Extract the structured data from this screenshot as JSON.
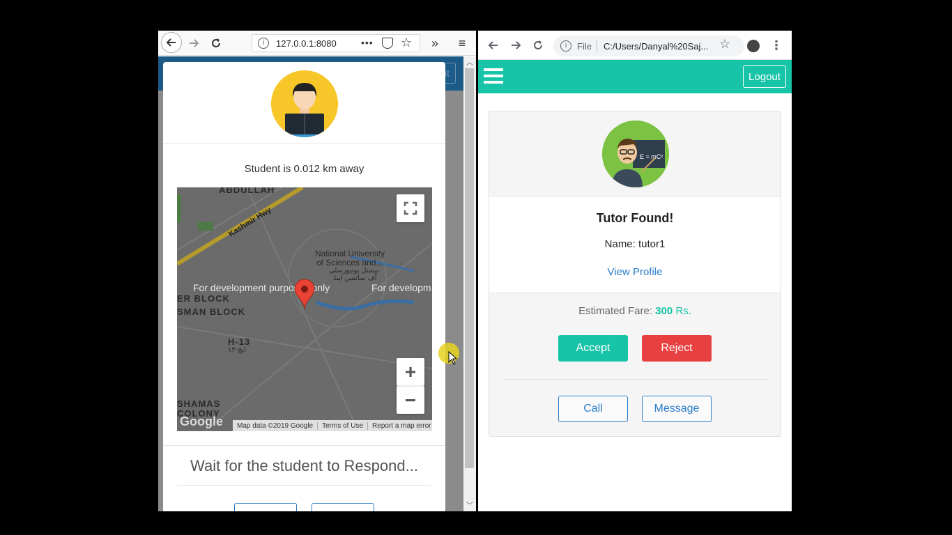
{
  "left_browser": {
    "url": "127.0.0.1:8080",
    "nav_icons": [
      "back-icon",
      "forward-icon",
      "reload-icon",
      "info-icon",
      "more-icon",
      "pocket-icon",
      "star-icon",
      "overflow-icon",
      "menu-icon"
    ],
    "background_logout": "Logout",
    "modal": {
      "distance_text": "Student is 0.012 km away",
      "map": {
        "labels": {
          "abdullah": "ABDULLAH",
          "kashmir_hwy": "Kashmir Hwy",
          "university": "National University",
          "university_2": "of Sciences and...",
          "urdu_1": "نیشنل یونیورسٹی",
          "urdu_2": "آف سائنس اینڈ",
          "dev_1": "For development purposes only",
          "dev_2": "For developm",
          "er_block": "ER BLOCK",
          "usman_block": "SMAN BLOCK",
          "h13": "H-13",
          "h13_urdu": "ایچ-۱۳",
          "shamas": "SHAMAS",
          "colony": "COLONY"
        },
        "google_logo": "Google",
        "footer": [
          "Map data ©2019 Google",
          "Terms of Use",
          "Report a map error"
        ],
        "zoom_in": "+",
        "zoom_out": "−"
      },
      "wait_text": "Wait for the student to Respond..."
    }
  },
  "right_browser": {
    "file_label": "File",
    "url": "C:/Users/Danyal%20Saj...",
    "navbar": {
      "logout": "Logout"
    },
    "card": {
      "title": "Tutor Found!",
      "name": "Name: tutor1",
      "view_profile": "View Profile",
      "fare_label": "Estimated Fare:",
      "fare_value": "300",
      "fare_unit": "Rs.",
      "accept": "Accept",
      "reject": "Reject",
      "call": "Call",
      "message": "Message"
    },
    "colors": {
      "primary": "#17c4a7",
      "danger": "#e84040",
      "link": "#2b7ec9"
    }
  }
}
